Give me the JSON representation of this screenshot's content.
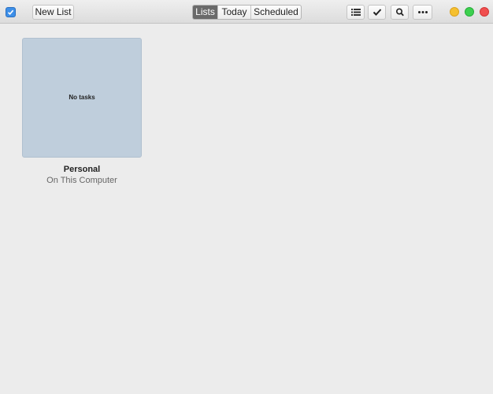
{
  "toolbar": {
    "app_icon": "checkbox-icon",
    "new_list_label": "New List",
    "tabs": [
      {
        "label": "Lists",
        "active": true
      },
      {
        "label": "Today",
        "active": false
      },
      {
        "label": "Scheduled",
        "active": false
      }
    ],
    "icons": [
      "list-icon",
      "check-icon",
      "search-icon",
      "more-icon"
    ]
  },
  "window_controls": {
    "minimize_color": "#f5c02f",
    "maximize_color": "#3dd04f",
    "close_color": "#f04f4f"
  },
  "lists": [
    {
      "preview_text": "No tasks",
      "title": "Personal",
      "subtitle": "On This Computer",
      "color": "#bfcedc"
    }
  ]
}
